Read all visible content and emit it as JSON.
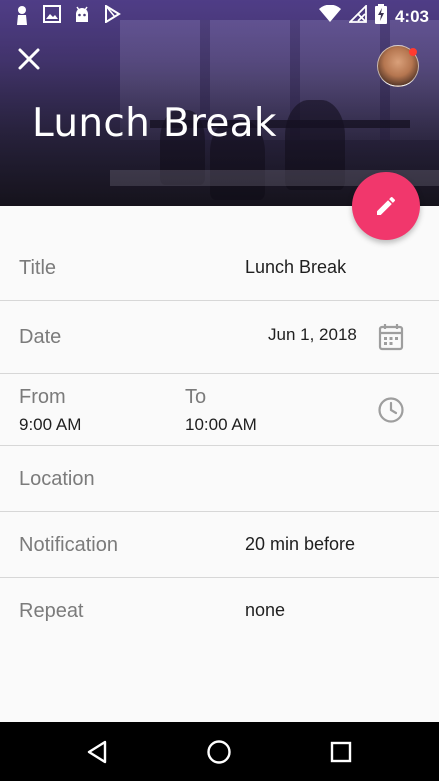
{
  "status_bar": {
    "time": "4:03",
    "notification_icons": [
      "person-icon",
      "image-icon",
      "android-icon",
      "play-store-icon"
    ],
    "system_icons": [
      "wifi-icon",
      "no-signal-icon",
      "battery-charging-icon"
    ]
  },
  "header": {
    "title": "Lunch Break",
    "close_icon": "close-icon",
    "avatar_badge_color": "#ff3b30"
  },
  "fab": {
    "icon": "pencil-icon",
    "color": "#f1376c"
  },
  "form": {
    "title": {
      "label": "Title",
      "value": "Lunch Break"
    },
    "date": {
      "label": "Date",
      "value": "Jun 1, 2018",
      "icon": "calendar-icon"
    },
    "time": {
      "from_label": "From",
      "from_value": "9:00 AM",
      "to_label": "To",
      "to_value": "10:00 AM",
      "icon": "clock-icon"
    },
    "location": {
      "label": "Location",
      "value": ""
    },
    "notification": {
      "label": "Notification",
      "value": "20 min before"
    },
    "repeat": {
      "label": "Repeat",
      "value": "none"
    }
  },
  "nav_bar": {
    "buttons": [
      "back-icon",
      "home-icon",
      "recents-icon"
    ]
  }
}
